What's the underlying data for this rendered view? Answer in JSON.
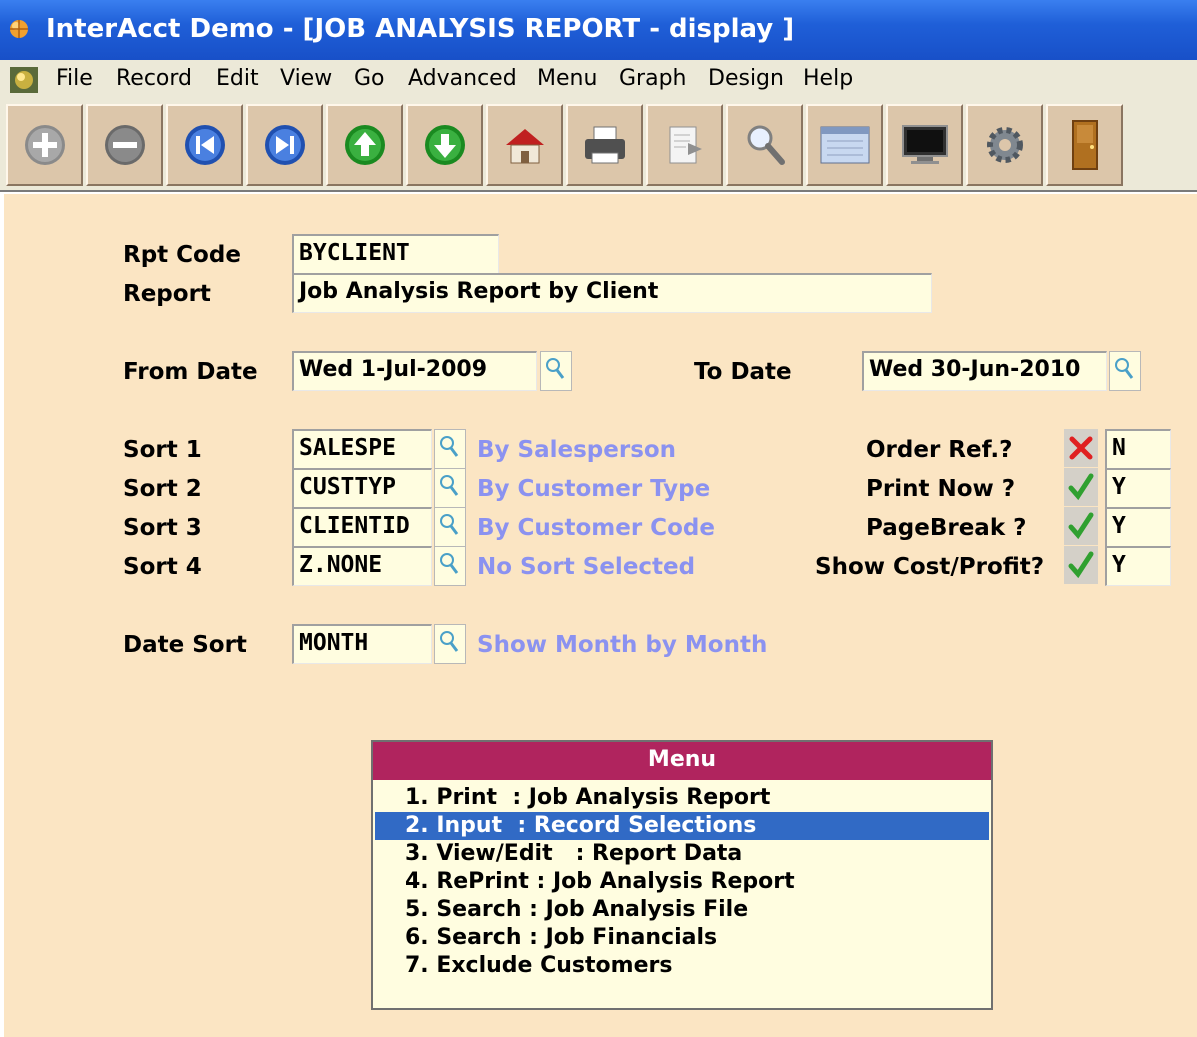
{
  "window": {
    "title": "InterAcct Demo - [JOB ANALYSIS REPORT - display ]"
  },
  "menubar": {
    "items": [
      "File",
      "Record",
      "Edit",
      "View",
      "Go",
      "Advanced",
      "Menu",
      "Graph",
      "Design",
      "Help"
    ]
  },
  "toolbar": {
    "buttons": [
      "add-icon",
      "remove-icon",
      "first-record-icon",
      "last-record-icon",
      "previous-icon",
      "next-icon",
      "home-icon",
      "print-icon",
      "export-icon",
      "search-icon",
      "data-icon",
      "screen-icon",
      "settings-icon",
      "exit-door-icon"
    ]
  },
  "form": {
    "rpt_code": {
      "label": "Rpt Code",
      "value": "BYCLIENT"
    },
    "report": {
      "label": "Report",
      "value": "Job Analysis Report by Client"
    },
    "from_date": {
      "label": "From Date",
      "value": "Wed 1-Jul-2009"
    },
    "to_date": {
      "label": "To Date",
      "value": "Wed 30-Jun-2010"
    },
    "sorts": [
      {
        "label": "Sort 1",
        "value": "SALESPE",
        "desc": "By Salesperson"
      },
      {
        "label": "Sort 2",
        "value": "CUSTTYP",
        "desc": "By Customer Type"
      },
      {
        "label": "Sort 3",
        "value": "CLIENTID",
        "desc": "By Customer Code"
      },
      {
        "label": "Sort 4",
        "value": "Z.NONE",
        "desc": "No Sort Selected"
      }
    ],
    "date_sort": {
      "label": "Date Sort",
      "value": "MONTH",
      "desc": "Show Month by Month"
    },
    "flags": [
      {
        "label": "Order Ref.?",
        "icon": "cross-icon",
        "value": "N"
      },
      {
        "label": "Print Now  ?",
        "icon": "check-icon",
        "value": "Y"
      },
      {
        "label": "PageBreak  ?",
        "icon": "check-icon",
        "value": "Y"
      },
      {
        "label": "Show Cost/Profit?",
        "icon": "check-icon",
        "value": "Y"
      }
    ]
  },
  "menu": {
    "title": "Menu",
    "selected_index": 1,
    "items": [
      "1. Print  : Job Analysis Report",
      "2. Input  : Record Selections",
      "3. View/Edit   : Report Data",
      "4. RePrint : Job Analysis Report",
      "5. Search : Job Analysis File",
      "6. Search : Job Financials",
      "7. Exclude Customers"
    ]
  },
  "colors": {
    "title_bar": "#1f5fd8",
    "form_bg": "#fbe5c3",
    "field_bg": "#fffde0",
    "desc_text": "#8b92f0",
    "menu_header": "#b0245e",
    "menu_selected": "#316ac5"
  }
}
